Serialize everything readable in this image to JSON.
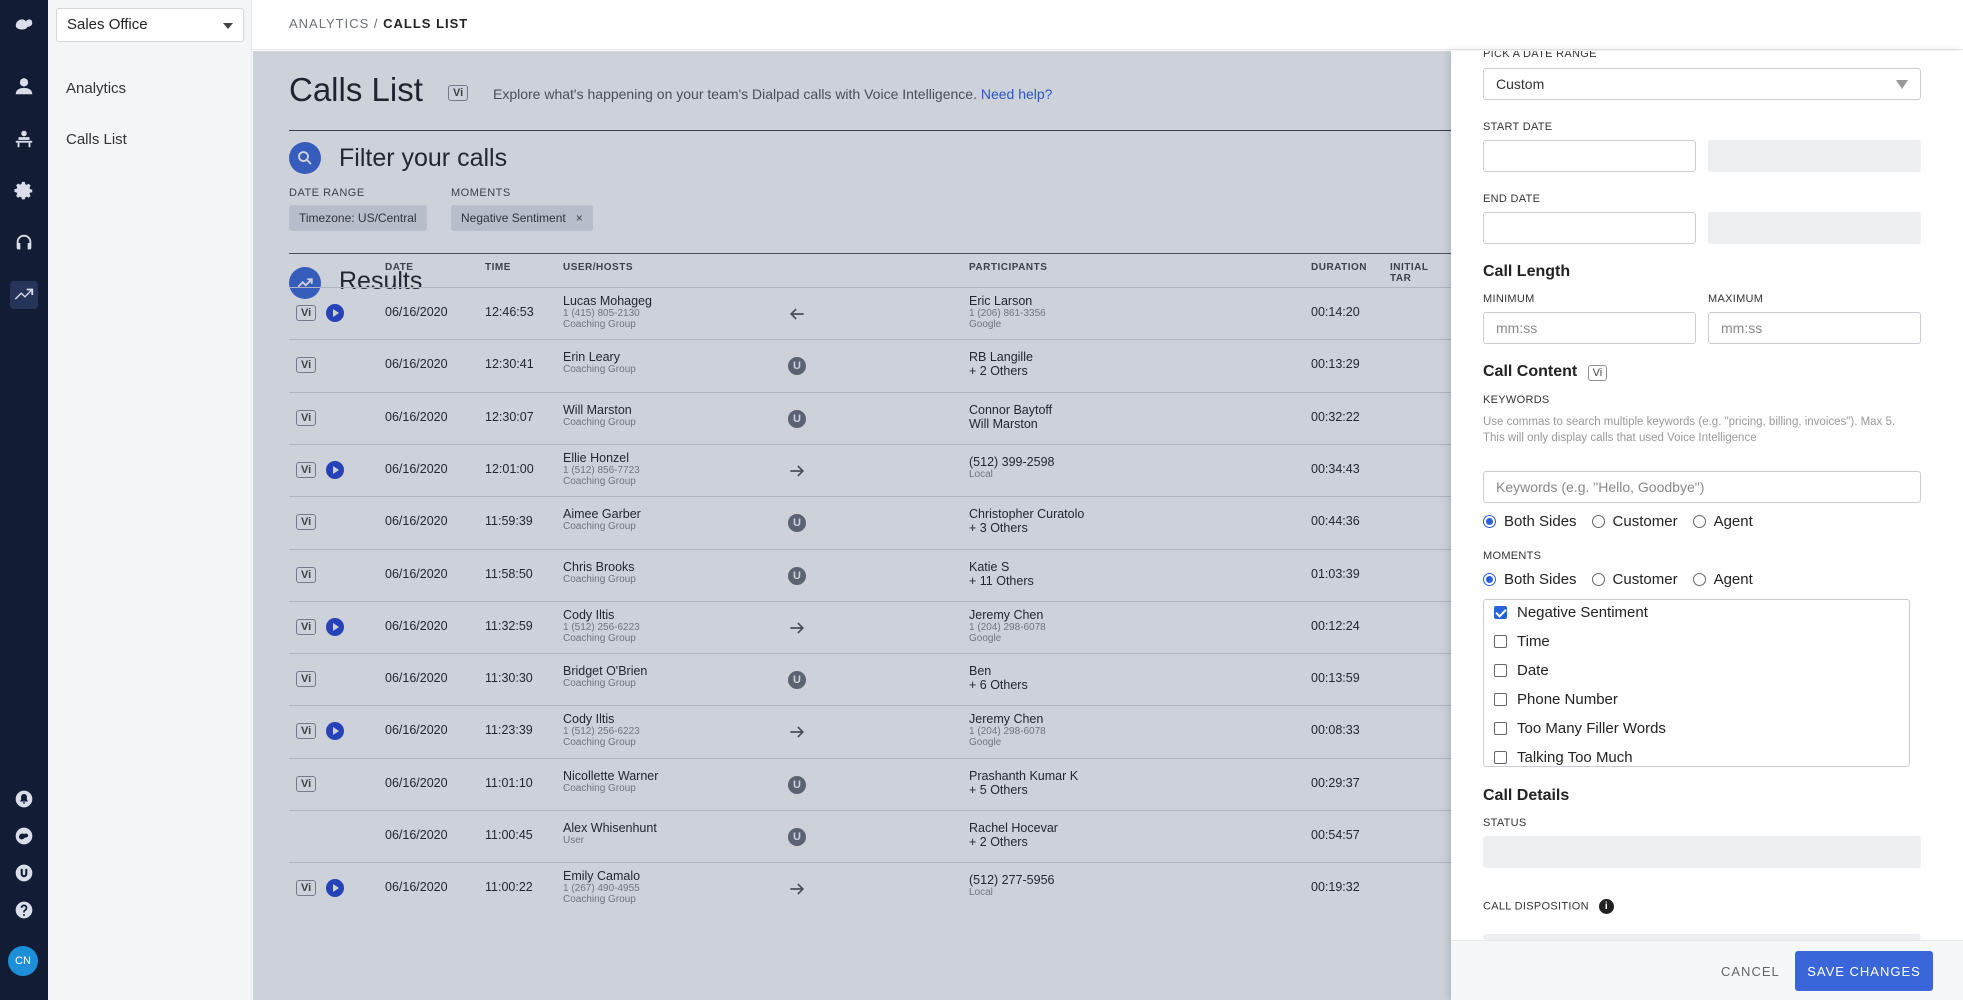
{
  "nav": {
    "office_select": "Sales Office",
    "items": [
      {
        "label": "Analytics"
      },
      {
        "label": "Calls List"
      }
    ],
    "avatar": "CN"
  },
  "breadcrumb": {
    "parent": "ANALYTICS",
    "sep": " / ",
    "current": "CALLS LIST"
  },
  "page": {
    "title": "Calls List",
    "vi": "Vi",
    "description": "Explore what's happening on your team's Dialpad calls with Voice Intelligence.",
    "help_link": "Need help?"
  },
  "filter": {
    "title": "Filter your calls",
    "date_range_label": "DATE RANGE",
    "date_range_chip": "Timezone:  US/Central",
    "moments_label": "MOMENTS",
    "moments_chip": "Negative Sentiment",
    "chip_close": "×"
  },
  "results": {
    "title": "Results",
    "columns": [
      "DATE",
      "TIME",
      "USER/HOSTS",
      "PARTICIPANTS",
      "DURATION",
      "INITIAL TAR"
    ],
    "rows": [
      {
        "vi": true,
        "play": true,
        "date": "06/16/2020",
        "time": "12:46:53",
        "user": "Lucas Mohageg",
        "user_sub1": "1 (415) 805-2130",
        "user_sub2": "Coaching Group",
        "dir": "in",
        "part": "Eric Larson",
        "part_sub1": "1 (206) 861-3356",
        "part_sub2": "Google",
        "duration": "00:14:20"
      },
      {
        "vi": true,
        "play": false,
        "date": "06/16/2020",
        "time": "12:30:41",
        "user": "Erin Leary",
        "user_sub1": "Coaching Group",
        "user_sub2": "",
        "dir": "u",
        "part": "RB Langille",
        "part_sub1": "+ 2 Others",
        "part_sub2": "",
        "duration": "00:13:29"
      },
      {
        "vi": true,
        "play": false,
        "date": "06/16/2020",
        "time": "12:30:07",
        "user": "Will Marston",
        "user_sub1": "Coaching Group",
        "user_sub2": "",
        "dir": "u",
        "part": "Connor Baytoff",
        "part_sub1": "Will Marston",
        "part_sub2": "",
        "duration": "00:32:22"
      },
      {
        "vi": true,
        "play": true,
        "date": "06/16/2020",
        "time": "12:01:00",
        "user": "Ellie Honzel",
        "user_sub1": "1 (512) 856-7723",
        "user_sub2": "Coaching Group",
        "dir": "out",
        "part": "(512) 399-2598",
        "part_sub1": "Local",
        "part_sub2": "",
        "duration": "00:34:43"
      },
      {
        "vi": true,
        "play": false,
        "date": "06/16/2020",
        "time": "11:59:39",
        "user": "Aimee Garber",
        "user_sub1": "Coaching Group",
        "user_sub2": "",
        "dir": "u",
        "part": "Christopher Curatolo",
        "part_sub1": "+ 3 Others",
        "part_sub2": "",
        "duration": "00:44:36"
      },
      {
        "vi": true,
        "play": false,
        "date": "06/16/2020",
        "time": "11:58:50",
        "user": "Chris Brooks",
        "user_sub1": "Coaching Group",
        "user_sub2": "",
        "dir": "u",
        "part": "Katie S",
        "part_sub1": "+ 11 Others",
        "part_sub2": "",
        "duration": "01:03:39"
      },
      {
        "vi": true,
        "play": true,
        "date": "06/16/2020",
        "time": "11:32:59",
        "user": "Cody Iltis",
        "user_sub1": "1 (512) 256-6223",
        "user_sub2": "Coaching Group",
        "dir": "out",
        "part": "Jeremy Chen",
        "part_sub1": "1 (204) 298-6078",
        "part_sub2": "Google",
        "duration": "00:12:24"
      },
      {
        "vi": true,
        "play": false,
        "date": "06/16/2020",
        "time": "11:30:30",
        "user": "Bridget O'Brien",
        "user_sub1": "Coaching Group",
        "user_sub2": "",
        "dir": "u",
        "part": "Ben",
        "part_sub1": "+ 6 Others",
        "part_sub2": "",
        "duration": "00:13:59"
      },
      {
        "vi": true,
        "play": true,
        "date": "06/16/2020",
        "time": "11:23:39",
        "user": "Cody Iltis",
        "user_sub1": "1 (512) 256-6223",
        "user_sub2": "Coaching Group",
        "dir": "out",
        "part": "Jeremy Chen",
        "part_sub1": "1 (204) 298-6078",
        "part_sub2": "Google",
        "duration": "00:08:33"
      },
      {
        "vi": true,
        "play": false,
        "date": "06/16/2020",
        "time": "11:01:10",
        "user": "Nicollette Warner",
        "user_sub1": "Coaching Group",
        "user_sub2": "",
        "dir": "u",
        "part": "Prashanth Kumar K",
        "part_sub1": "+ 5 Others",
        "part_sub2": "",
        "duration": "00:29:37"
      },
      {
        "vi": false,
        "play": false,
        "date": "06/16/2020",
        "time": "11:00:45",
        "user": "Alex Whisenhunt",
        "user_sub1": "User",
        "user_sub2": "",
        "dir": "u",
        "part": "Rachel Hocevar",
        "part_sub1": "+ 2 Others",
        "part_sub2": "",
        "duration": "00:54:57"
      },
      {
        "vi": true,
        "play": true,
        "date": "06/16/2020",
        "time": "11:00:22",
        "user": "Emily Camalo",
        "user_sub1": "1 (267) 490-4955",
        "user_sub2": "Coaching Group",
        "dir": "out",
        "part": "(512) 277-5956",
        "part_sub1": "Local",
        "part_sub2": "",
        "duration": "00:19:32"
      }
    ]
  },
  "panel": {
    "date_range_label": "PICK A DATE RANGE",
    "date_range_value": "Custom",
    "start_date_label": "START DATE",
    "end_date_label": "END DATE",
    "call_length_title": "Call Length",
    "minimum_label": "MINIMUM",
    "maximum_label": "MAXIMUM",
    "min_placeholder": "mm:ss",
    "max_placeholder": "mm:ss",
    "call_content_title": "Call Content",
    "vi": "Vi",
    "keywords_label": "KEYWORDS",
    "keywords_help1": "Use commas to search multiple keywords (e.g. \"pricing, billing, invoices\"). Max 5.",
    "keywords_help2": "This will only display calls that used Voice Intelligence",
    "keywords_placeholder": "Keywords (e.g. \"Hello, Goodbye\")",
    "sides": [
      "Both Sides",
      "Customer",
      "Agent"
    ],
    "moments_label": "MOMENTS",
    "moments_options": [
      {
        "label": "Negative Sentiment",
        "checked": true
      },
      {
        "label": "Time",
        "checked": false
      },
      {
        "label": "Date",
        "checked": false
      },
      {
        "label": "Phone Number",
        "checked": false
      },
      {
        "label": "Too Many Filler Words",
        "checked": false
      },
      {
        "label": "Talking Too Much",
        "checked": false
      }
    ],
    "call_details_title": "Call Details",
    "status_label": "STATUS",
    "disposition_label": "CALL DISPOSITION",
    "info_glyph": "i",
    "cancel": "CANCEL",
    "save": "SAVE CHANGES"
  }
}
